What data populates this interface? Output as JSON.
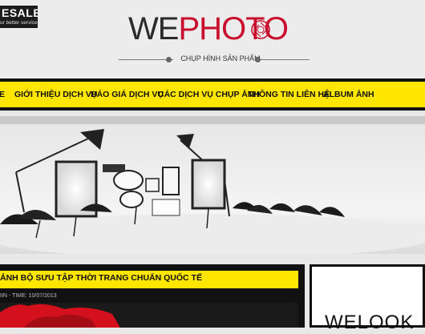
{
  "badge": {
    "big": "ESALE",
    "small": "ur better service"
  },
  "logo": {
    "we": "WE",
    "photo": "PHOTO"
  },
  "tagline": "CHỤP HÌNH SẢN PHẨM",
  "nav": {
    "items": [
      {
        "label": "E"
      },
      {
        "label": "GIỚI THIỆU DỊCH VỤ"
      },
      {
        "label": "BÁO GIÁ DỊCH VỤ"
      },
      {
        "label": "CÁC DỊCH VỤ CHỤP ẢNH"
      },
      {
        "label": "THÔNG TIN LIÊN HỆ"
      },
      {
        "label": "ALBUM ẢNH"
      }
    ]
  },
  "post": {
    "title": "ẢNH BỘ SƯU TẬP THỜI TRANG CHUẨN QUỐC TẾ",
    "meta": "IIN - TIME: 10/07/2013"
  },
  "sidebar": {
    "text": "WELOOK"
  },
  "colors": {
    "accent": "#ffe600",
    "brand_red": "#c8102e",
    "dark": "#111111"
  },
  "icons": [
    "camera-aperture-icon"
  ]
}
